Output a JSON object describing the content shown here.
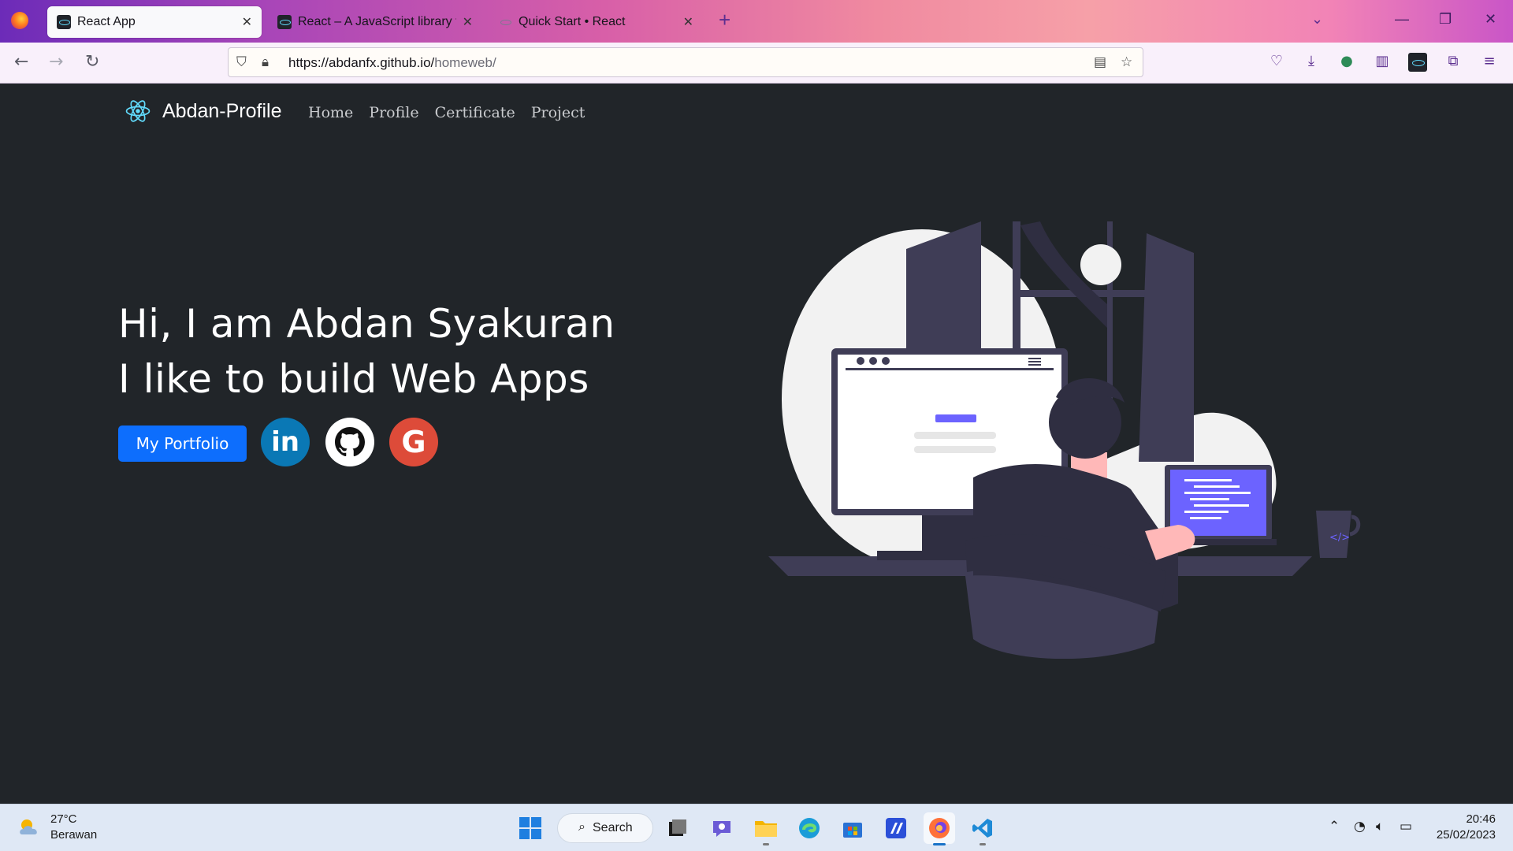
{
  "browser": {
    "tabs": [
      {
        "title": "React App",
        "active": true
      },
      {
        "title": "React – A JavaScript library for b",
        "active": false
      },
      {
        "title": "Quick Start • React",
        "active": false
      }
    ],
    "url_host": "https://abdanfx.github.io/",
    "url_path": "homeweb/",
    "toolbar_icons": [
      "pocket-icon",
      "download-icon",
      "extension-globe-icon",
      "notes-icon",
      "react-devtools-icon",
      "extensions-icon",
      "menu-icon"
    ]
  },
  "site": {
    "brand": "Abdan-Profile",
    "nav": [
      "Home",
      "Profile",
      "Certificate",
      "Project"
    ],
    "hero_line1": "Hi, I am Abdan Syakuran",
    "hero_line2": "I like to build Web Apps",
    "portfolio_button": "My Portfolio",
    "social": [
      "linkedin",
      "github",
      "google"
    ]
  },
  "taskbar": {
    "temperature": "27°C",
    "weather": "Berawan",
    "search_label": "Search",
    "time": "20:46",
    "date": "25/02/2023"
  },
  "colors": {
    "page_bg": "#212529",
    "primary": "#0d6efd",
    "react": "#61dafb",
    "illustration_accent": "#6c63ff"
  }
}
